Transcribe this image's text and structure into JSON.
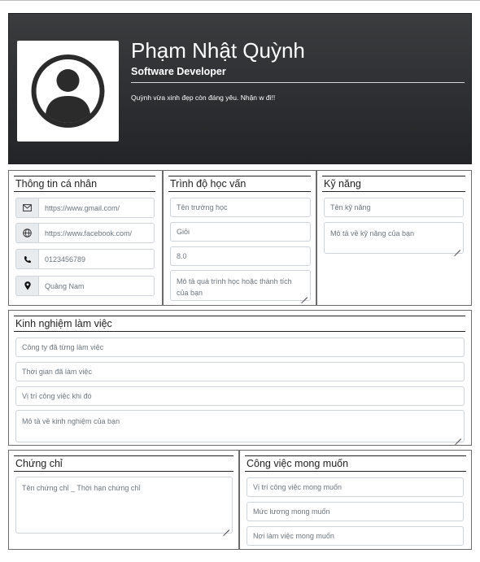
{
  "profile": {
    "name": "Phạm Nhật Quỳnh",
    "role": "Software Developer",
    "bio": "Quỳnh vừa xinh đẹp còn đáng yêu. Nhận w đi!!"
  },
  "personal": {
    "title": "Thông tin cá nhân",
    "email": "https://www.gmail.com/",
    "website": "https://www.facebook.com/",
    "phone": "0123456789",
    "location": "Quảng Nam"
  },
  "education": {
    "title": "Trình độ học vấn",
    "school_placeholder": "Tên trường học",
    "rank": "Giỏi",
    "gpa": "8.0",
    "desc_placeholder": "Mô tả quá trình học hoặc thành tích của bạn"
  },
  "skills": {
    "title": "Kỹ năng",
    "name_placeholder": "Tên kỹ năng",
    "desc_placeholder": "Mô tả về kỹ năng của bạn"
  },
  "experience": {
    "title": "Kinh nghiệm làm việc",
    "company_placeholder": "Công ty đã từng làm việc",
    "time_placeholder": "Thời gian đã làm việc",
    "position_placeholder": "Vị trí công việc khi đó",
    "desc_placeholder": "Mô tả về kinh nghiệm của bạn"
  },
  "certificates": {
    "title": "Chứng chỉ",
    "placeholder": "Tên chứng chỉ _ Thời hạn chứng chỉ"
  },
  "desired_job": {
    "title": "Công việc mong muốn",
    "position_placeholder": "Vị trí công việc mong muốn",
    "salary_placeholder": "Mức lương mong muốn",
    "place_placeholder": "Nơi làm việc mong muốn"
  },
  "icons": {
    "email": "envelope-icon",
    "website": "globe-icon",
    "phone": "phone-icon",
    "location": "map-pin-icon",
    "avatar": "user-circle-icon"
  }
}
